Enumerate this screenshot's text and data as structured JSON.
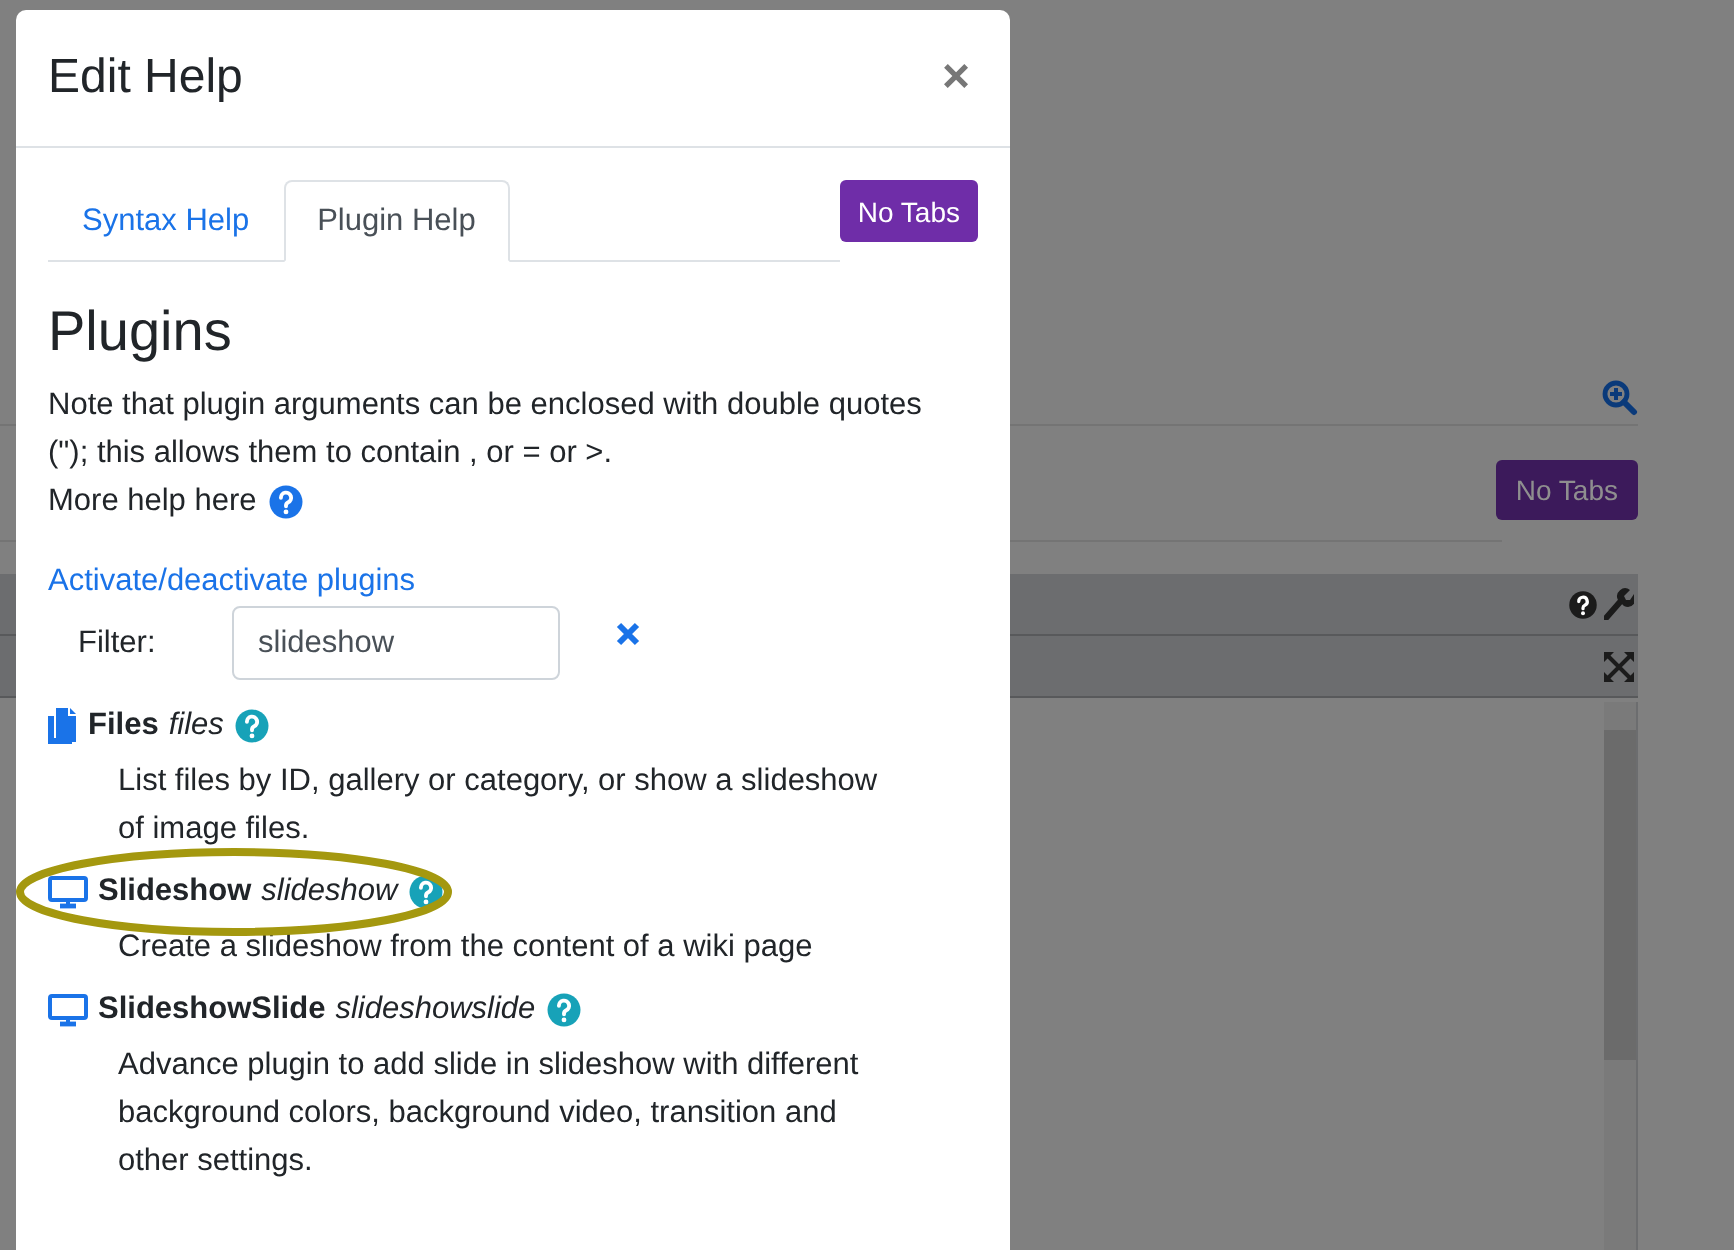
{
  "background": {
    "no_tabs_button": "No Tabs"
  },
  "modal": {
    "title": "Edit Help",
    "close": "×",
    "tabs": [
      {
        "label": "Syntax Help",
        "selected": false
      },
      {
        "label": "Plugin Help",
        "selected": true
      }
    ],
    "no_tabs_button": "No Tabs",
    "heading": "Plugins",
    "note": "Note that plugin arguments can be enclosed with double quotes (\"); this allows them to contain , or = or >.",
    "more_help": "More help here",
    "activate_link": "Activate/deactivate plugins",
    "filter": {
      "label": "Filter:",
      "value": "slideshow"
    },
    "plugins": [
      {
        "kind": "files",
        "name": "Files",
        "keyword": "files",
        "description": "List files by ID, gallery or category, or show a slideshow of image files.",
        "highlighted": false
      },
      {
        "kind": "monitor",
        "name": "Slideshow",
        "keyword": "slideshow",
        "description": "Create a slideshow from the content of a wiki page",
        "highlighted": true
      },
      {
        "kind": "monitor",
        "name": "SlideshowSlide",
        "keyword": "slideshowslide",
        "description": "Advance plugin to add slide in slideshow with different background colors, background video, transition and other settings.",
        "highlighted": false
      }
    ]
  }
}
